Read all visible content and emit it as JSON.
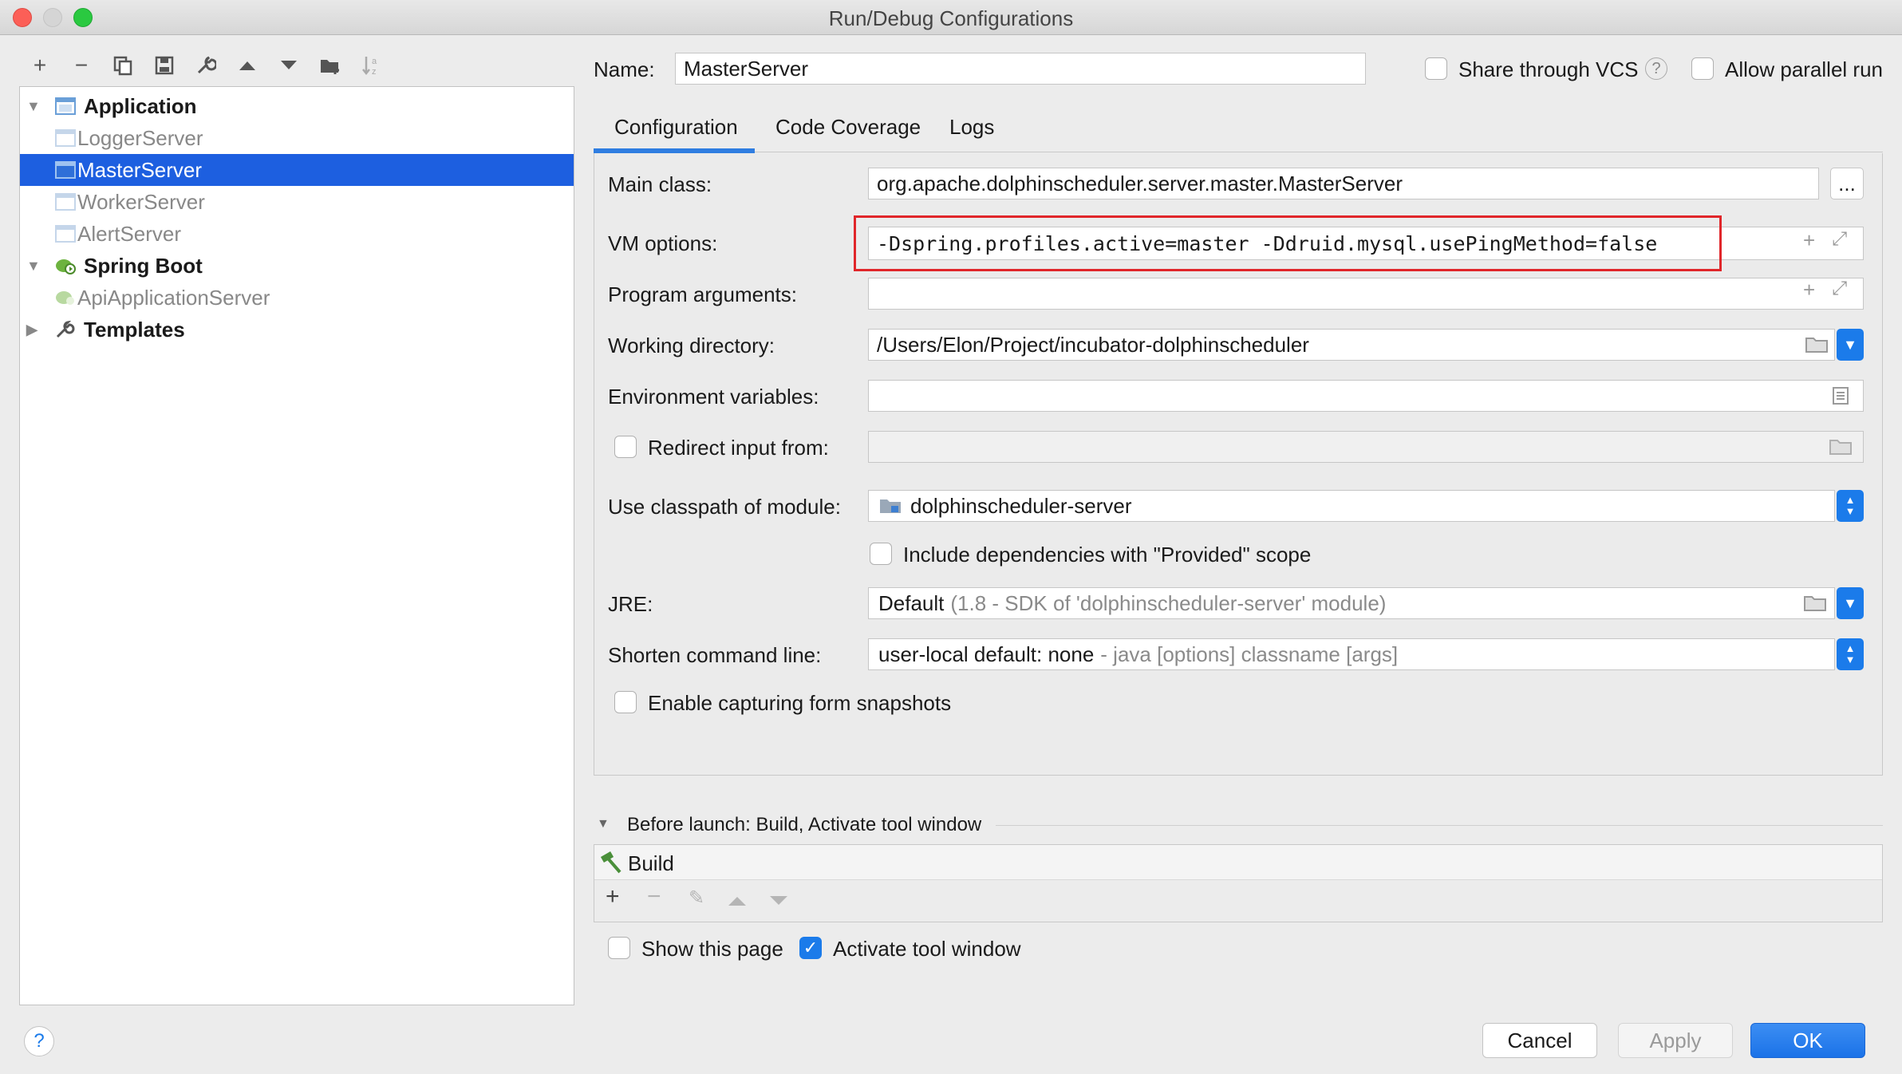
{
  "window": {
    "title": "Run/Debug Configurations"
  },
  "toolbar": {
    "add": "+",
    "remove": "−"
  },
  "tree": {
    "application": "Application",
    "items": [
      "LoggerServer",
      "MasterServer",
      "WorkerServer",
      "AlertServer"
    ],
    "spring_boot": "Spring Boot",
    "spring_items": [
      "ApiApplicationServer"
    ],
    "templates": "Templates"
  },
  "header": {
    "name_label": "Name:",
    "name_value": "MasterServer",
    "share_vcs": "Share through VCS",
    "allow_parallel": "Allow parallel run"
  },
  "tabs": [
    "Configuration",
    "Code Coverage",
    "Logs"
  ],
  "form": {
    "main_class_label": "Main class:",
    "main_class_value": "org.apache.dolphinscheduler.server.master.MasterServer",
    "main_class_browse": "...",
    "vm_options_label": "VM options:",
    "vm_options_value": "-Dspring.profiles.active=master -Ddruid.mysql.usePingMethod=false",
    "program_args_label": "Program arguments:",
    "program_args_value": "",
    "working_dir_label": "Working directory:",
    "working_dir_value": "/Users/Elon/Project/incubator-dolphinscheduler",
    "env_vars_label": "Environment variables:",
    "env_vars_value": "",
    "redirect_label": "Redirect input from:",
    "classpath_label": "Use classpath of module:",
    "classpath_value": "dolphinscheduler-server",
    "include_deps_label": "Include dependencies with \"Provided\" scope",
    "jre_label": "JRE:",
    "jre_value": "Default",
    "jre_hint": "(1.8 - SDK of 'dolphinscheduler-server' module)",
    "shorten_label": "Shorten command line:",
    "shorten_value": "user-local default: none",
    "shorten_hint": "- java [options] classname [args]",
    "snapshots_label": "Enable capturing form snapshots"
  },
  "before_launch": {
    "title": "Before launch: Build, Activate tool window",
    "items": [
      "Build"
    ],
    "show_page": "Show this page",
    "activate_tool_window": "Activate tool window",
    "activate_checked": true
  },
  "buttons": {
    "cancel": "Cancel",
    "apply": "Apply",
    "ok": "OK",
    "help": "?"
  },
  "colors": {
    "selection": "#1d5fe0",
    "accent": "#1b7bea",
    "highlight_box": "#e0262a"
  }
}
